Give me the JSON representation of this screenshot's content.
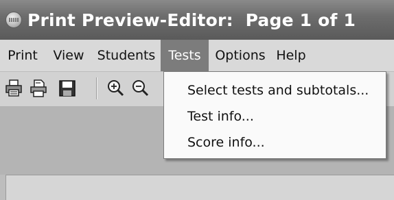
{
  "window": {
    "title": "Print Preview-Editor:  Page 1 of 1",
    "icon": "app-badge-icon"
  },
  "menubar": {
    "items": [
      {
        "label": "Print"
      },
      {
        "label": "View"
      },
      {
        "label": "Students"
      },
      {
        "label": "Tests",
        "active": true
      },
      {
        "label": "Options"
      },
      {
        "label": "Help"
      }
    ]
  },
  "toolbar": {
    "icons": [
      "print-icon",
      "print-setup-icon",
      "save-icon",
      "zoom-in-icon",
      "zoom-out-icon"
    ]
  },
  "dropdown": {
    "items": [
      {
        "label": "Select tests and subtotals..."
      },
      {
        "label": "Test info..."
      },
      {
        "label": "Score info..."
      }
    ]
  },
  "colors": {
    "titlebar": "#6d6d6d",
    "menu_active": "#7c7c7c",
    "menubar": "#d9d9d9",
    "dropdown_bg": "#fafafa"
  }
}
